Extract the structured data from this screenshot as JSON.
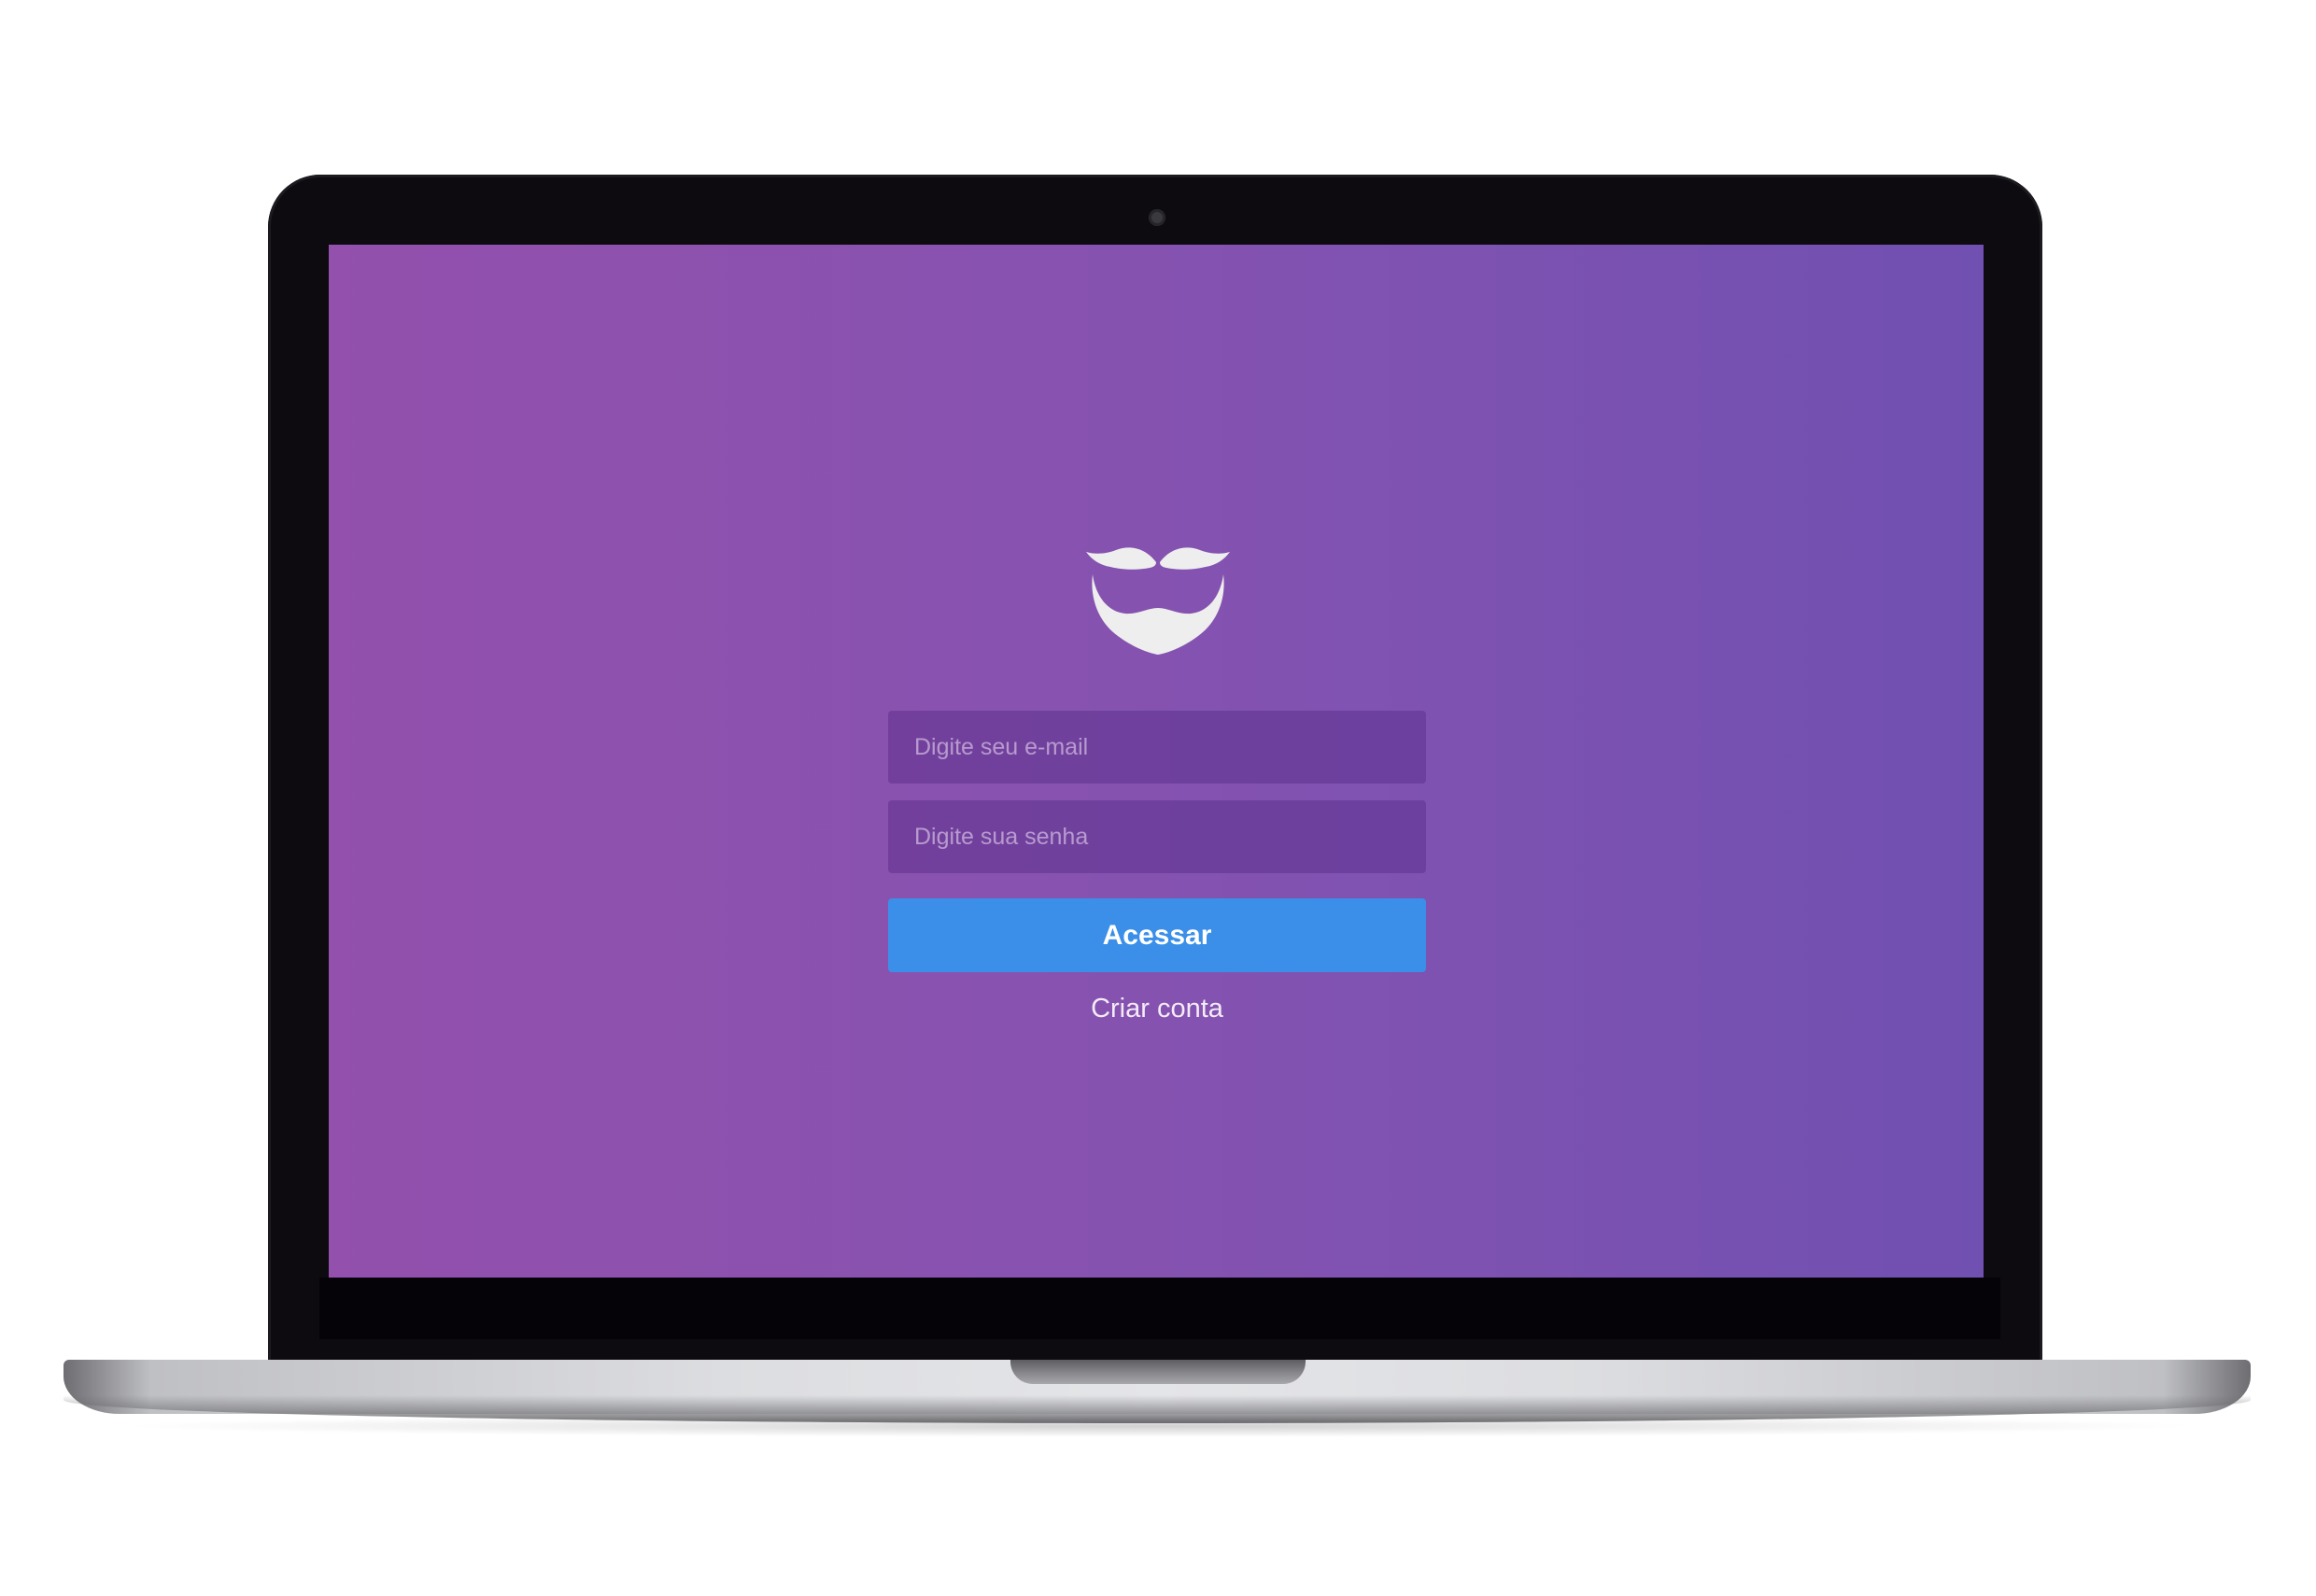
{
  "app": {
    "brand_icon": "mustache-beard-icon"
  },
  "login": {
    "email_placeholder": "Digite seu e-mail",
    "password_placeholder": "Digite sua senha",
    "submit_label": "Acessar",
    "create_account_label": "Criar conta"
  },
  "colors": {
    "background_gradient_start": "#9350ad",
    "background_gradient_end": "#7050b1",
    "button": "#3b8fe8",
    "input_background": "rgba(80,40,130,0.42)",
    "logo": "#eeeeee"
  }
}
